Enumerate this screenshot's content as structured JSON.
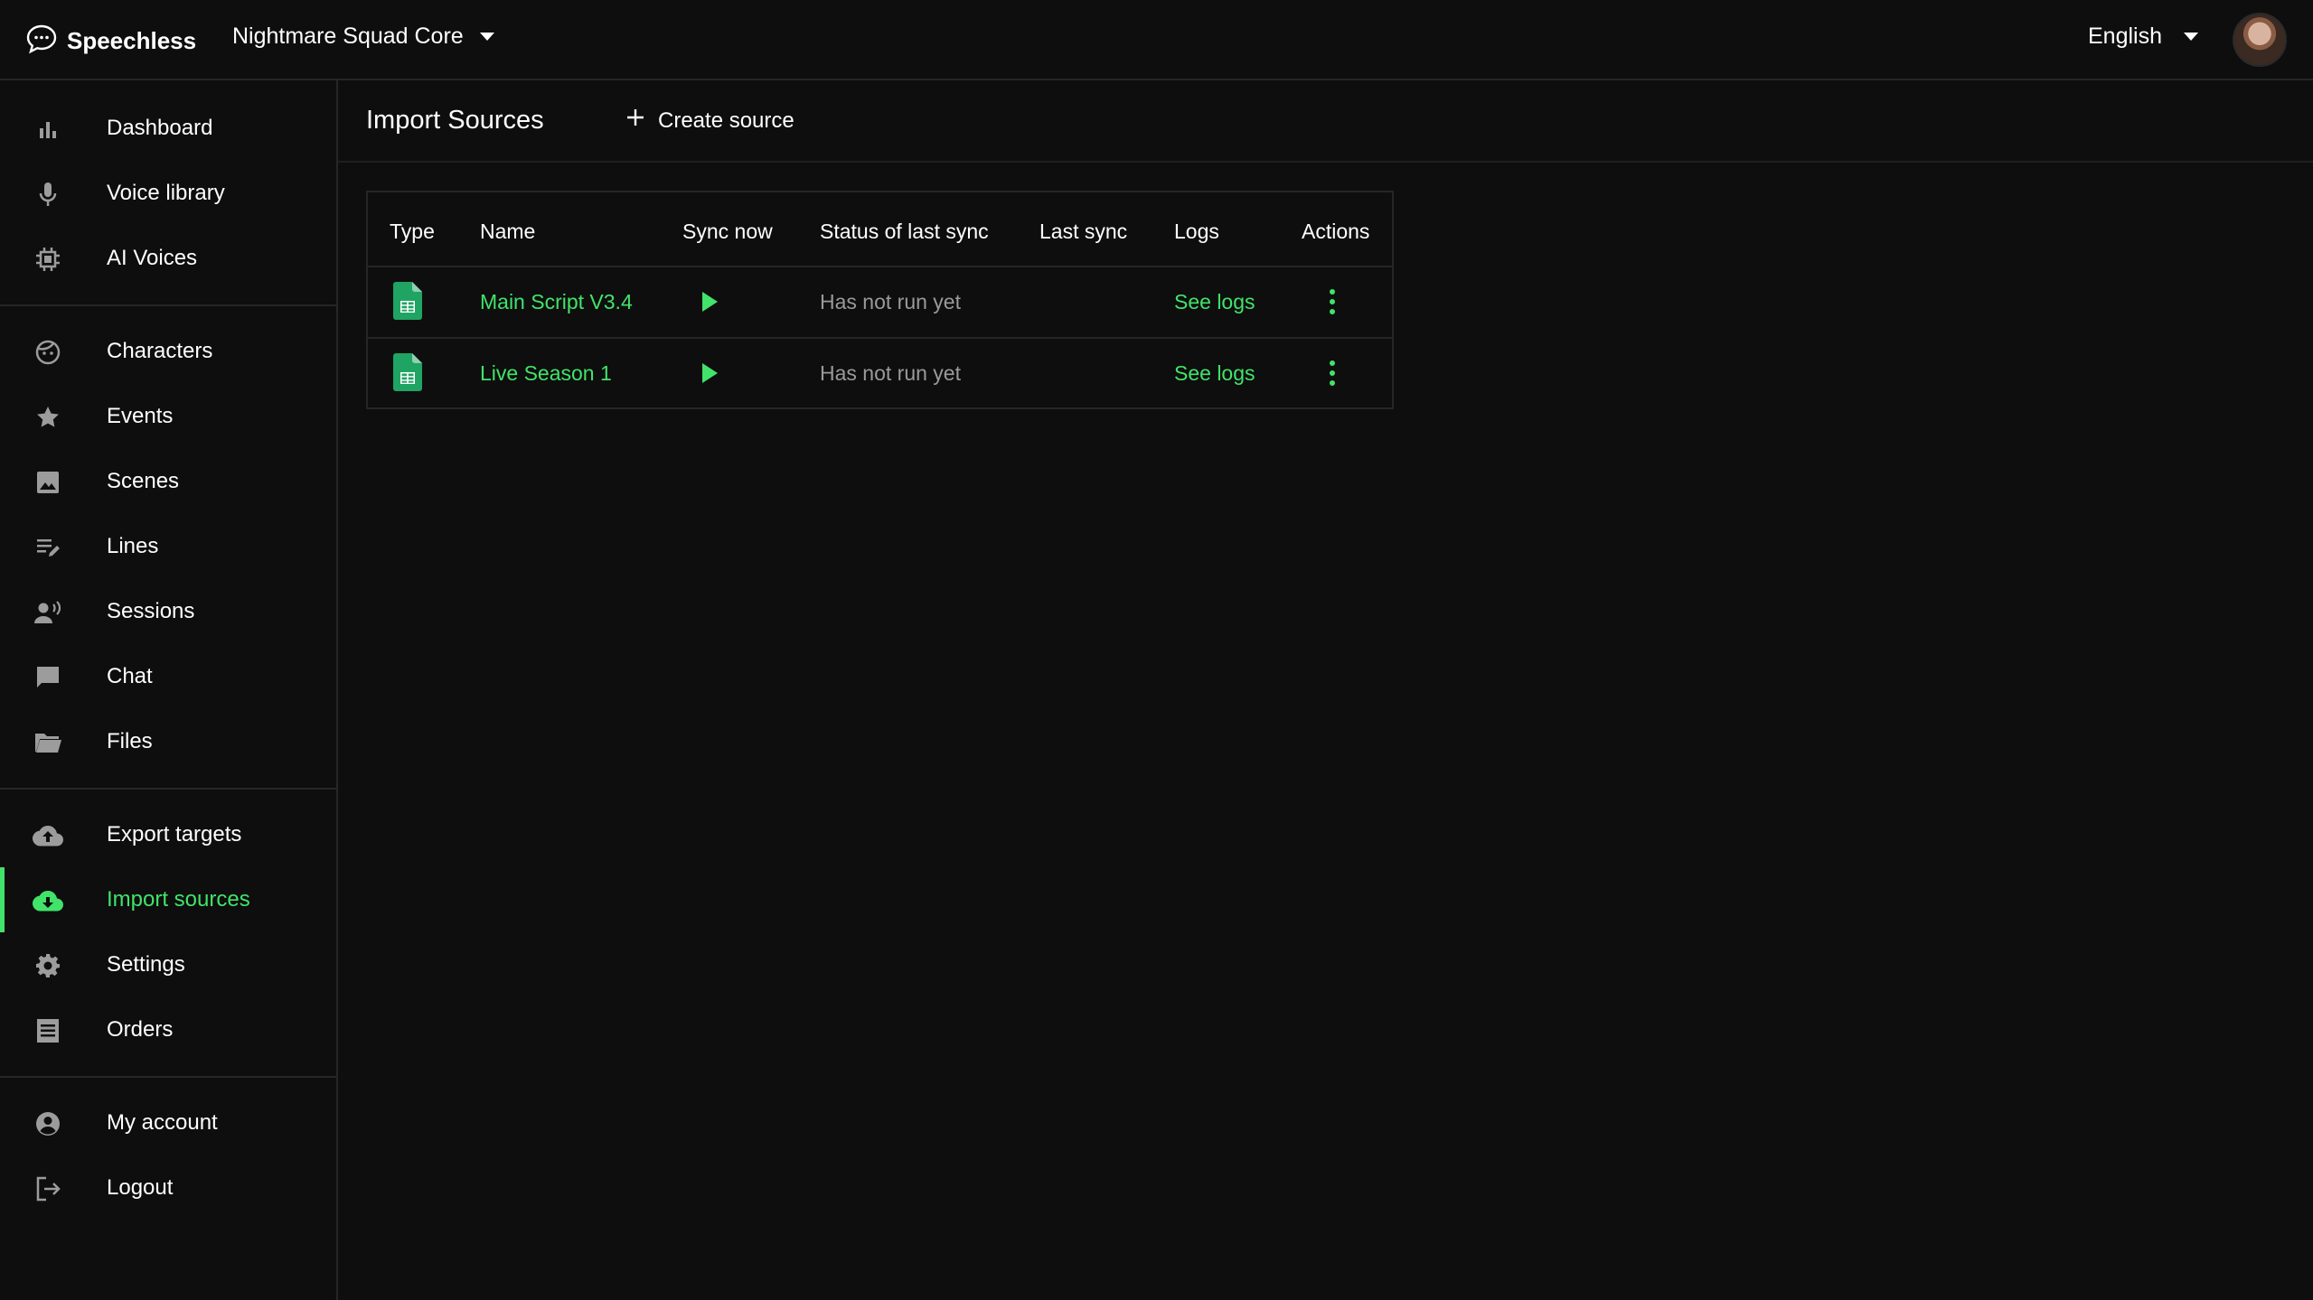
{
  "app": {
    "name": "Speechless",
    "logo_icon": "speech-bubble-icon"
  },
  "header": {
    "project": "Nightmare Squad Core",
    "language": "English"
  },
  "sidebar": {
    "items": [
      {
        "label": "Dashboard",
        "icon": "bar-chart-icon"
      },
      {
        "label": "Voice library",
        "icon": "microphone-icon"
      },
      {
        "label": "AI Voices",
        "icon": "chip-icon"
      },
      {
        "label": "Characters",
        "icon": "face-icon"
      },
      {
        "label": "Events",
        "icon": "star-icon"
      },
      {
        "label": "Scenes",
        "icon": "image-icon"
      },
      {
        "label": "Lines",
        "icon": "edit-lines-icon"
      },
      {
        "label": "Sessions",
        "icon": "speaking-person-icon"
      },
      {
        "label": "Chat",
        "icon": "chat-icon"
      },
      {
        "label": "Files",
        "icon": "folder-icon"
      },
      {
        "label": "Export targets",
        "icon": "cloud-upload-icon"
      },
      {
        "label": "Import sources",
        "icon": "cloud-download-icon",
        "active": true
      },
      {
        "label": "Settings",
        "icon": "gear-icon"
      },
      {
        "label": "Orders",
        "icon": "receipt-icon"
      },
      {
        "label": "My account",
        "icon": "account-circle-icon"
      },
      {
        "label": "Logout",
        "icon": "logout-icon"
      }
    ]
  },
  "main": {
    "title": "Import Sources",
    "create_label": "Create source",
    "table": {
      "columns": [
        "Type",
        "Name",
        "Sync now",
        "Status of last sync",
        "Last sync",
        "Logs",
        "Actions"
      ],
      "rows": [
        {
          "type_icon": "google-sheets-icon",
          "name": "Main Script V3.4",
          "status": "Has not run yet",
          "last_sync": "",
          "logs": "See logs"
        },
        {
          "type_icon": "google-sheets-icon",
          "name": "Live Season 1",
          "status": "Has not run yet",
          "last_sync": "",
          "logs": "See logs"
        }
      ]
    }
  },
  "colors": {
    "accent": "#41e36a",
    "background": "#0e0e0e",
    "muted": "#9a9a9a",
    "sheet_green": "#1fa463"
  }
}
